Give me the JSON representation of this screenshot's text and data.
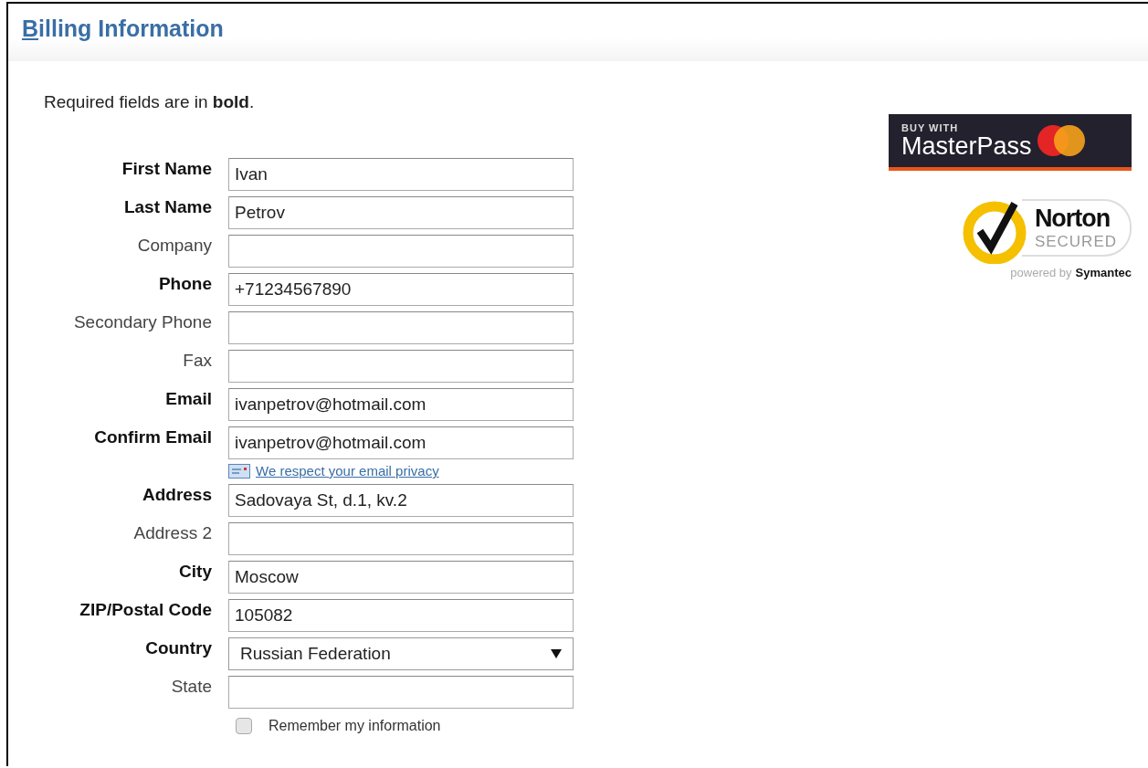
{
  "header": {
    "title": "Billing Information"
  },
  "intro": "Required fields are in **bold**.",
  "fields": [
    {
      "kind": "text",
      "label": "First Name",
      "required": true,
      "value": "Ivan"
    },
    {
      "kind": "text",
      "label": "Last Name",
      "required": true,
      "value": "Petrov"
    },
    {
      "kind": "text",
      "label": "Company",
      "required": false
    },
    {
      "kind": "text",
      "label": "Phone",
      "required": true,
      "value": "+71234567890"
    },
    {
      "kind": "text",
      "label": "Secondary Phone",
      "required": false
    },
    {
      "kind": "text",
      "label": "Fax",
      "required": false
    },
    {
      "kind": "text",
      "label": "Email",
      "required": true,
      "value": "ivanpetrov@hotmail.com"
    },
    {
      "kind": "text",
      "label": "Confirm Email",
      "required": true,
      "value": "ivanpetrov@hotmail.com",
      "note": "We respect your email privacy"
    },
    {
      "kind": "text",
      "label": "Address",
      "required": true,
      "value": "Sadovaya St, d.1, kv.2"
    },
    {
      "kind": "text",
      "label": "Address 2",
      "required": false
    },
    {
      "kind": "text",
      "label": "City",
      "required": true,
      "value": "Moscow"
    },
    {
      "kind": "text",
      "label": "ZIP/Postal Code",
      "required": true,
      "value": "105082"
    },
    {
      "kind": "select",
      "label": "Country",
      "required": true,
      "value": "Russian Federation"
    },
    {
      "kind": "text",
      "label": "State",
      "required": false
    }
  ],
  "remember": {
    "label": "Remember my information",
    "checked": false
  },
  "masterpass": {
    "top": "BUY WITH",
    "name": "MasterPass"
  },
  "norton": {
    "name": "Norton",
    "sub": "SECURED",
    "powered": "powered by",
    "brand": "Symantec"
  }
}
